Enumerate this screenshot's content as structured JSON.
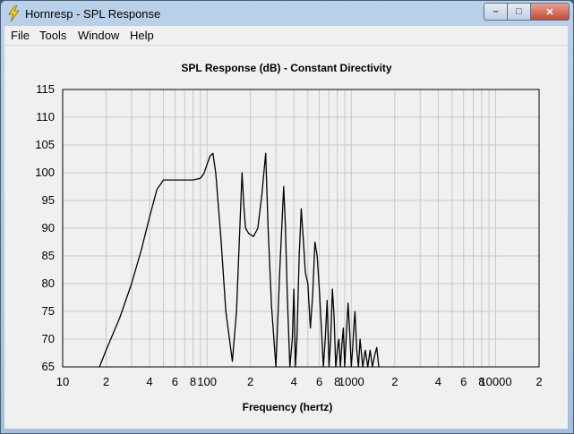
{
  "window": {
    "title": "Hornresp - SPL Response",
    "min_glyph": "–",
    "max_glyph": "□",
    "close_glyph": "✕"
  },
  "menu": {
    "items": [
      {
        "id": "file",
        "label": "File"
      },
      {
        "id": "tools",
        "label": "Tools"
      },
      {
        "id": "window",
        "label": "Window"
      },
      {
        "id": "help",
        "label": "Help"
      }
    ]
  },
  "icons": {
    "app": "lightning-icon"
  },
  "colors": {
    "curve": "#000000",
    "grid": "#c8c8c8",
    "window_frame": "#b9d1ea"
  },
  "chart_data": {
    "type": "line",
    "title": "SPL Response (dB) - Constant Directivity",
    "xlabel": "Frequency (hertz)",
    "ylabel": "",
    "xscale": "log",
    "xlim": [
      10,
      20000
    ],
    "ylim": [
      65,
      115
    ],
    "grid": true,
    "yticks": [
      65,
      70,
      75,
      80,
      85,
      90,
      95,
      100,
      105,
      110,
      115
    ],
    "ytick_labels": [
      "65",
      "70",
      "75",
      "80",
      "85",
      "90",
      "95",
      "100",
      "105",
      "110",
      "115"
    ],
    "xticks": [
      10,
      20,
      40,
      60,
      80,
      100,
      200,
      400,
      600,
      800,
      1000,
      2000,
      4000,
      6000,
      8000,
      10000,
      20000
    ],
    "xtick_labels": [
      "10",
      "2",
      "4",
      "6",
      "8",
      "100",
      "2",
      "4",
      "6",
      "8",
      "1000",
      "2",
      "4",
      "6",
      "8",
      "10000",
      "2"
    ],
    "series": [
      {
        "x": [
          18,
          20,
          25,
          30,
          35,
          40,
          45,
          50,
          60,
          70,
          80,
          90,
          95,
          100,
          105,
          110,
          115,
          125,
          135,
          150,
          160,
          175,
          180,
          185,
          195,
          210,
          225,
          240,
          255,
          265,
          280,
          300,
          320,
          340,
          350,
          360,
          375,
          390,
          400,
          410,
          420,
          435,
          450,
          465,
          480,
          500,
          520,
          540,
          560,
          580,
          600,
          620,
          640,
          660,
          680,
          700,
          720,
          740,
          760,
          780,
          800,
          820,
          840,
          860,
          880,
          900,
          920,
          950,
          980,
          1000,
          1020,
          1040,
          1060,
          1090,
          1120,
          1150,
          1200,
          1250,
          1300,
          1350,
          1400,
          1450,
          1500,
          1550
        ],
        "y": [
          65,
          68,
          74,
          80,
          86,
          92,
          97,
          98.7,
          98.7,
          98.7,
          98.7,
          99,
          99.8,
          101.5,
          103,
          103.5,
          100,
          88,
          75,
          66,
          75,
          100,
          94,
          90,
          89,
          88.5,
          90,
          96,
          103.5,
          90,
          76,
          65,
          83,
          97.5,
          90,
          78,
          65,
          70,
          79,
          65,
          70,
          85,
          93.5,
          88,
          82,
          80,
          72,
          78,
          87.5,
          85,
          79,
          72,
          65,
          70,
          77,
          65,
          70,
          79,
          74,
          65,
          68,
          70,
          65,
          69,
          72,
          65,
          70,
          76.5,
          70,
          65,
          68,
          72,
          75,
          68,
          65,
          70,
          65,
          68,
          65,
          68,
          65,
          67,
          68.5,
          65
        ]
      }
    ]
  }
}
